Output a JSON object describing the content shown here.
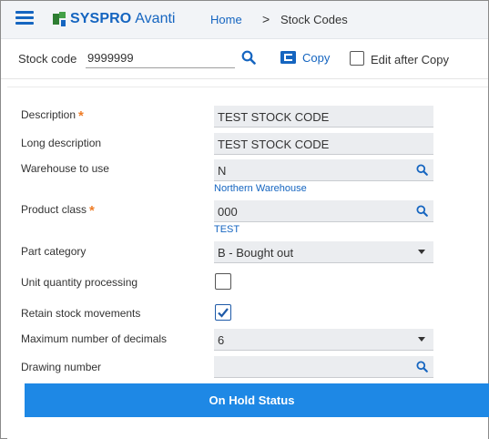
{
  "header": {
    "brand": "SYSPRO",
    "brand_sub": "Avanti",
    "breadcrumb_home": "Home",
    "breadcrumb_sep": ">",
    "breadcrumb_current": "Stock Codes",
    "accent_color": "#1565c0"
  },
  "toolbar": {
    "stock_code_label": "Stock code",
    "stock_code_value": "9999999",
    "copy_label": "Copy",
    "edit_after_copy_label": "Edit after Copy",
    "edit_after_copy_checked": false
  },
  "form": {
    "description": {
      "label": "Description",
      "required_mark": "*",
      "value": "TEST STOCK CODE"
    },
    "long_description": {
      "label": "Long description",
      "value": "TEST STOCK CODE"
    },
    "warehouse": {
      "label": "Warehouse to use",
      "value": "N",
      "sub": "Northern Warehouse"
    },
    "product_class": {
      "label": "Product class",
      "required_mark": "*",
      "value": "000",
      "sub": "TEST"
    },
    "part_category": {
      "label": "Part category",
      "value": "B - Bought out"
    },
    "unit_quantity_processing": {
      "label": "Unit quantity processing",
      "checked": false
    },
    "retain_stock_movements": {
      "label": "Retain stock movements",
      "checked": true
    },
    "max_decimals": {
      "label": "Maximum number of decimals",
      "value": "6"
    },
    "drawing_number": {
      "label": "Drawing number",
      "value": ""
    }
  },
  "on_hold_button": {
    "label": "On Hold Status",
    "color": "#1e88e5"
  }
}
